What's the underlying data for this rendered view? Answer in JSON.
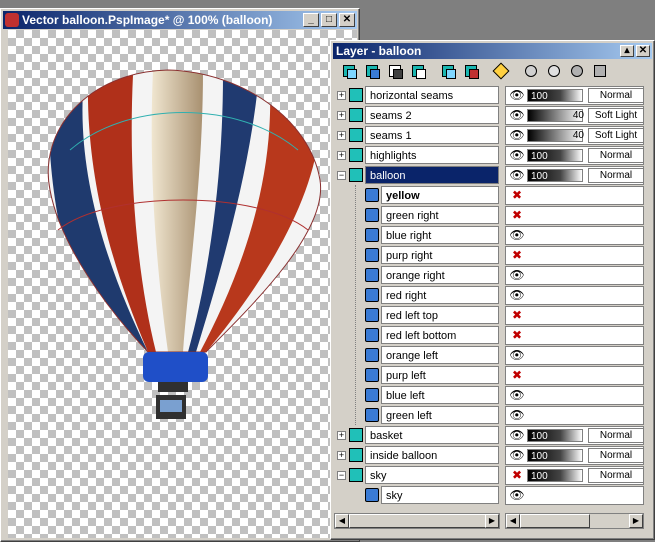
{
  "image_window": {
    "title": "Vector balloon.PspImage* @ 100% (balloon)"
  },
  "layer_palette": {
    "title": "Layer - balloon",
    "toolbar_icons": [
      "new-raster-layer-icon",
      "new-vector-layer-icon",
      "new-mask-layer-icon",
      "new-adjustment-layer-icon",
      "duplicate-layer-icon",
      "delete-layer-icon",
      "edit-selection-icon",
      "toggle-visibility-icon",
      "show-all-icon",
      "hide-all-icon",
      "layer-properties-icon"
    ],
    "layers": [
      {
        "name": "horizontal seams",
        "type": "group",
        "visible": true,
        "opacity": "100",
        "blend": "Normal"
      },
      {
        "name": "seams 2",
        "type": "group",
        "visible": true,
        "opacity": "40",
        "blend": "Soft Light"
      },
      {
        "name": "seams 1",
        "type": "group",
        "visible": true,
        "opacity": "40",
        "blend": "Soft Light"
      },
      {
        "name": "highlights",
        "type": "group",
        "visible": true,
        "opacity": "100",
        "blend": "Normal"
      },
      {
        "name": "balloon",
        "type": "group",
        "visible": true,
        "opacity": "100",
        "blend": "Normal",
        "selected": true
      },
      {
        "name": "yellow",
        "type": "vector",
        "visible": false,
        "bold": true
      },
      {
        "name": "green right",
        "type": "vector",
        "visible": false
      },
      {
        "name": "blue right",
        "type": "vector",
        "visible": true
      },
      {
        "name": "purp right",
        "type": "vector",
        "visible": false
      },
      {
        "name": "orange right",
        "type": "vector",
        "visible": true
      },
      {
        "name": "red right",
        "type": "vector",
        "visible": true
      },
      {
        "name": "red left top",
        "type": "vector",
        "visible": false
      },
      {
        "name": "red left bottom",
        "type": "vector",
        "visible": false
      },
      {
        "name": "orange left",
        "type": "vector",
        "visible": true
      },
      {
        "name": "purp left",
        "type": "vector",
        "visible": false
      },
      {
        "name": "blue left",
        "type": "vector",
        "visible": true
      },
      {
        "name": "green left",
        "type": "vector",
        "visible": true
      },
      {
        "name": "basket",
        "type": "group",
        "visible": true,
        "opacity": "100",
        "blend": "Normal"
      },
      {
        "name": "inside balloon",
        "type": "group",
        "visible": true,
        "opacity": "100",
        "blend": "Normal"
      },
      {
        "name": "sky",
        "type": "group",
        "visible": false,
        "opacity": "100",
        "blend": "Normal"
      },
      {
        "name": "sky",
        "type": "vector",
        "visible": true
      }
    ]
  }
}
